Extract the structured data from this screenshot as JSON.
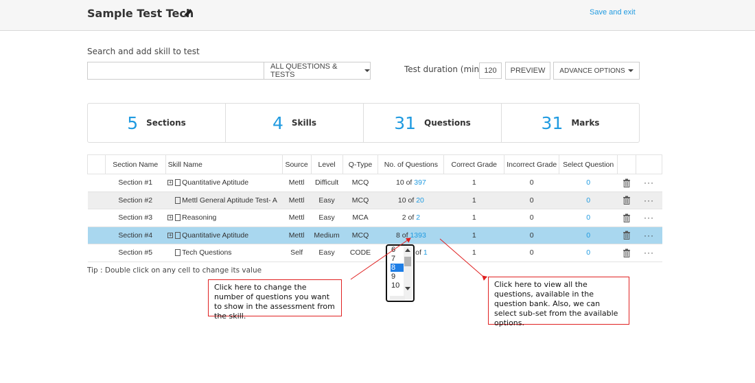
{
  "header": {
    "title": "Sample Test Tech",
    "save_exit": "Save and exit"
  },
  "search": {
    "label": "Search and add skill to test",
    "value": "",
    "placeholder": "",
    "filter_label": "ALL QUESTIONS & TESTS"
  },
  "duration": {
    "label": "Test duration (min)",
    "value": "120"
  },
  "buttons": {
    "preview": "PREVIEW",
    "advance": "ADVANCE OPTIONS"
  },
  "stats": [
    {
      "value": "5",
      "label": "Sections"
    },
    {
      "value": "4",
      "label": "Skills"
    },
    {
      "value": "31",
      "label": "Questions"
    },
    {
      "value": "31",
      "label": "Marks"
    }
  ],
  "table": {
    "headers": [
      "Section Name",
      "Skill Name",
      "Source",
      "Level",
      "Q-Type",
      "No. of Questions",
      "Correct Grade",
      "Incorrect Grade",
      "Select Question"
    ],
    "rows": [
      {
        "section": "Section #1",
        "expand": "+",
        "skill": "Quantitative Aptitude",
        "source": "Mettl",
        "level": "Difficult",
        "qtype": "MCQ",
        "count": "10",
        "of": "of",
        "total": "397",
        "correct": "1",
        "incorrect": "0",
        "select": "0"
      },
      {
        "section": "Section #2",
        "expand": "",
        "skill": "Mettl General Aptitude Test- A",
        "source": "Mettl",
        "level": "Easy",
        "qtype": "MCQ",
        "count": "10",
        "of": "of",
        "total": "20",
        "correct": "1",
        "incorrect": "0",
        "select": "0"
      },
      {
        "section": "Section #3",
        "expand": "+",
        "skill": "Reasoning",
        "source": "Mettl",
        "level": "Easy",
        "qtype": "MCA",
        "count": "2",
        "of": "of",
        "total": "2",
        "correct": "1",
        "incorrect": "0",
        "select": "0"
      },
      {
        "section": "Section #4",
        "expand": "+",
        "skill": "Quantitative Aptitude",
        "source": "Mettl",
        "level": "Medium",
        "qtype": "MCQ",
        "count": "8",
        "of": "of",
        "total": "1393",
        "correct": "1",
        "incorrect": "0",
        "select": "0"
      },
      {
        "section": "Section #5",
        "expand": "",
        "skill": "Tech Questions",
        "source": "Self",
        "level": "Easy",
        "qtype": "CODE",
        "count": "",
        "of": "of",
        "total": "1",
        "correct": "1",
        "incorrect": "0",
        "select": "0"
      }
    ],
    "more_label": "···"
  },
  "tip": "Tip : Double click on any cell to change its value",
  "dropdown": {
    "options": [
      "6",
      "7",
      "8",
      "9",
      "10"
    ],
    "selected": "8"
  },
  "callouts": {
    "count_help": "Click here to change the number of questions you want to show in the assessment  from the skill.",
    "total_help": "Click here to view all the questions, available in the question bank. Also, we can select sub-set from the available options."
  },
  "colors": {
    "accent": "#1f9ae0",
    "selected_row": "#a9d7ef",
    "callout_border": "#e02020"
  }
}
